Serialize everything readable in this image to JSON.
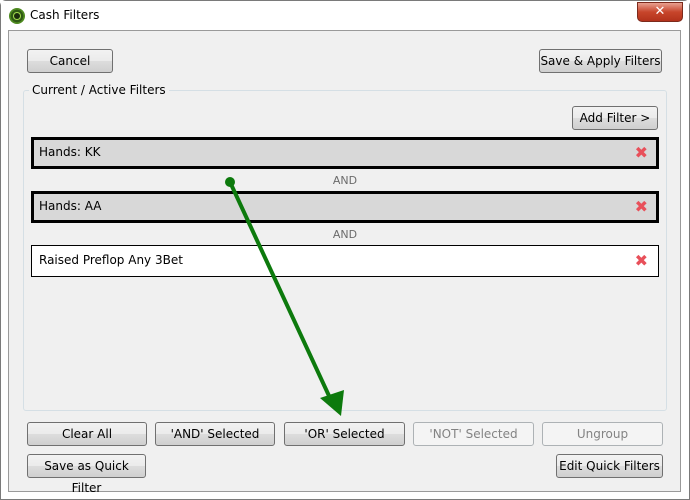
{
  "window": {
    "title": "Cash Filters",
    "close_label": "✕"
  },
  "top_buttons": {
    "cancel": "Cancel",
    "save_apply": "Save & Apply Filters"
  },
  "group": {
    "label": "Current / Active Filters",
    "add_filter": "Add Filter >"
  },
  "filters": [
    {
      "label": "Hands: KK",
      "selected": true,
      "remove_icon": "✖"
    },
    {
      "label": "Hands: AA",
      "selected": true,
      "remove_icon": "✖"
    },
    {
      "label": "Raised Preflop Any 3Bet",
      "selected": false,
      "remove_icon": "✖"
    }
  ],
  "connectors": [
    "AND",
    "AND"
  ],
  "bottom_buttons": {
    "clear_all": "Clear All",
    "and_selected": "'AND' Selected",
    "or_selected": "'OR' Selected",
    "not_selected": "'NOT' Selected",
    "ungroup": "Ungroup",
    "save_quick": "Save as Quick Filter",
    "edit_quick": "Edit Quick Filters"
  },
  "annotation": {
    "arrow_color": "#0d7a0d"
  }
}
